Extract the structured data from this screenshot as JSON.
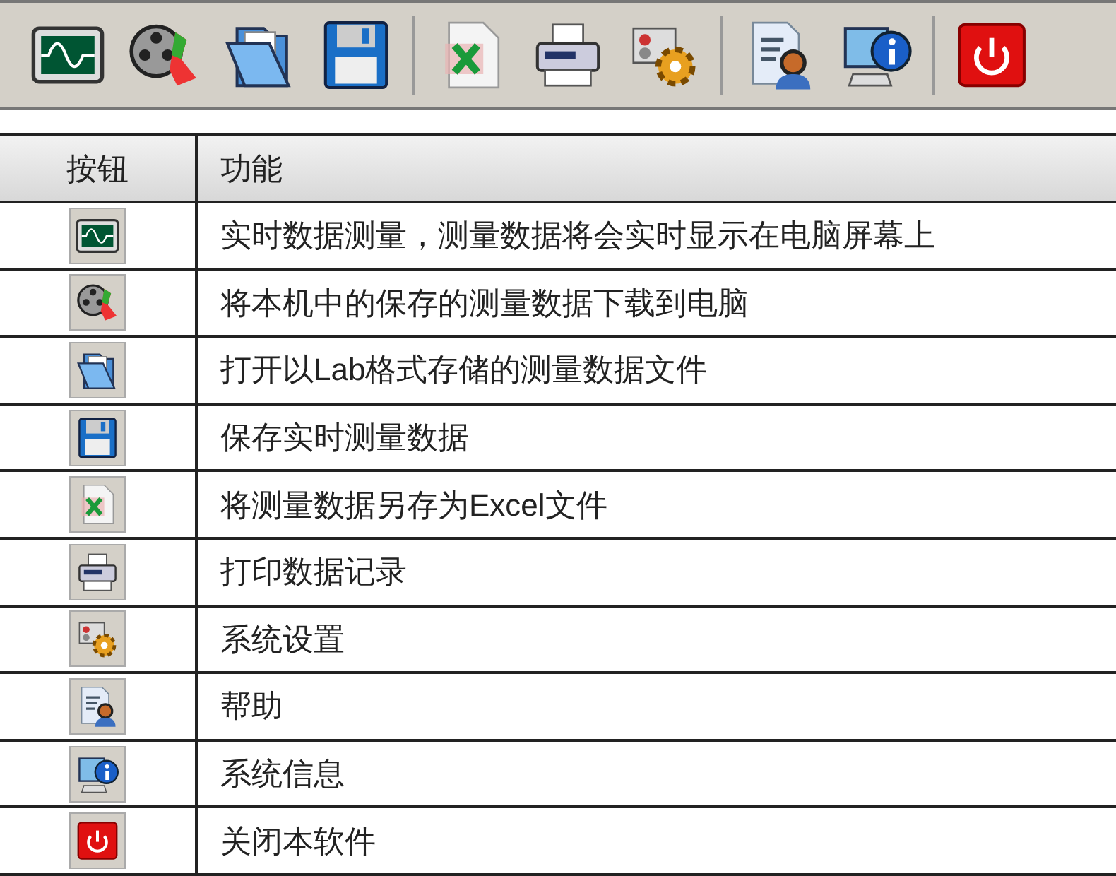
{
  "toolbar": {
    "groups": [
      {
        "buttons": [
          {
            "kind": "monitor"
          },
          {
            "kind": "film"
          },
          {
            "kind": "folder"
          },
          {
            "kind": "disk"
          }
        ]
      },
      {
        "buttons": [
          {
            "kind": "excel"
          },
          {
            "kind": "printer"
          },
          {
            "kind": "settings"
          }
        ]
      },
      {
        "buttons": [
          {
            "kind": "help"
          },
          {
            "kind": "info"
          }
        ]
      },
      {
        "buttons": [
          {
            "kind": "power"
          }
        ]
      }
    ]
  },
  "table": {
    "columns": [
      "按钮",
      "功能"
    ],
    "rows": [
      {
        "kind": "monitor",
        "function": "实时数据测量，测量数据将会实时显示在电脑屏幕上"
      },
      {
        "kind": "film",
        "function": "将本机中的保存的测量数据下载到电脑"
      },
      {
        "kind": "folder",
        "function": "打开以Lab格式存储的测量数据文件"
      },
      {
        "kind": "disk",
        "function": "保存实时测量数据"
      },
      {
        "kind": "excel",
        "function": "将测量数据另存为Excel文件"
      },
      {
        "kind": "printer",
        "function": "打印数据记录"
      },
      {
        "kind": "settings",
        "function": "系统设置"
      },
      {
        "kind": "help",
        "function": "帮助"
      },
      {
        "kind": "info",
        "function": "系统信息"
      },
      {
        "kind": "power",
        "function": "关闭本软件"
      }
    ]
  }
}
